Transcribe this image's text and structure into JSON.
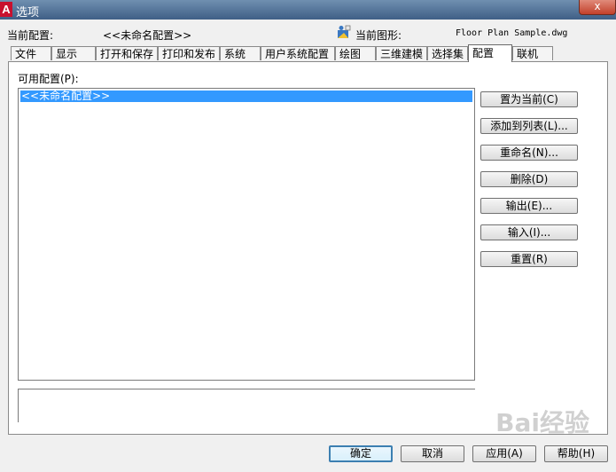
{
  "window": {
    "title": "选项",
    "close_label": "x"
  },
  "info": {
    "current_profile_label": "当前配置:",
    "current_profile_value": "<<未命名配置>>",
    "current_drawing_label": "当前图形:",
    "current_drawing_value": "Floor Plan Sample.dwg"
  },
  "tabs": [
    "文件",
    "显示",
    "打开和保存",
    "打印和发布",
    "系统",
    "用户系统配置",
    "绘图",
    "三维建模",
    "选择集",
    "配置",
    "联机"
  ],
  "active_tab": "配置",
  "panel": {
    "available_label": "可用配置(P):",
    "profiles": [
      "<<未命名配置>>"
    ],
    "buttons": {
      "set_current": "置为当前(C)",
      "add_to_list": "添加到列表(L)...",
      "rename": "重命名(N)...",
      "delete": "删除(D)",
      "export": "输出(E)...",
      "import": "输入(I)...",
      "reset": "重置(R)"
    }
  },
  "footer": {
    "ok": "确定",
    "cancel": "取消",
    "apply": "应用(A)",
    "help": "帮助(H)"
  },
  "colors": {
    "selection": "#3399ff",
    "titlebar": "#4a6a90"
  },
  "watermark": "Bai经验"
}
